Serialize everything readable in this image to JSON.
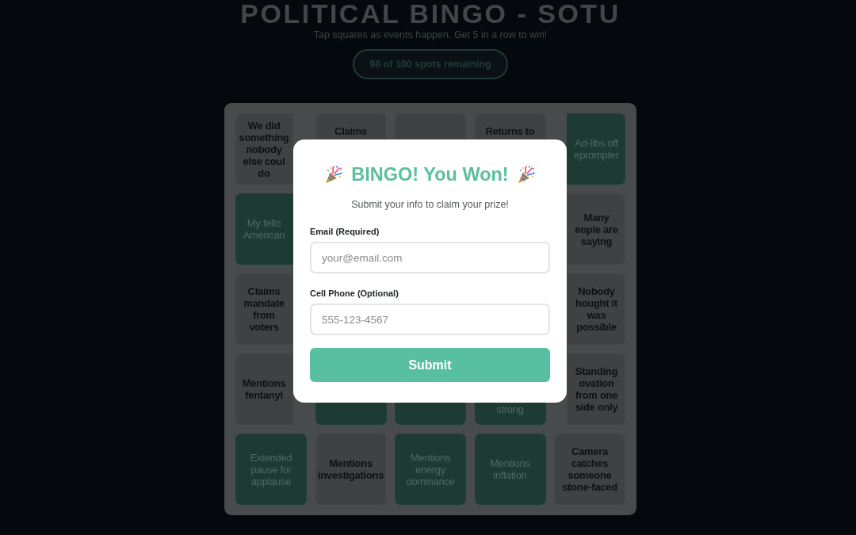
{
  "header": {
    "title": "POLITICAL BINGO - SOTU",
    "subtitle": "Tap squares as events happen. Get 5 in a row to win!",
    "spots_badge": "98 of 100 spots remaining"
  },
  "board": {
    "rows": [
      [
        {
          "text": "We did something nobody else coul do",
          "selected": false
        },
        {
          "text": "Claims",
          "selected": false
        },
        {
          "selected": false
        },
        {
          "text": "Returns to",
          "selected": false
        },
        {
          "text": "Ad-libs off eprompter",
          "selected": true
        }
      ],
      [
        {
          "text": "My fello American",
          "selected": true
        },
        null,
        null,
        null,
        {
          "text": "Many eople are saying",
          "selected": false
        }
      ],
      [
        {
          "text": "Claims mandate from voters",
          "selected": false
        },
        null,
        null,
        null,
        {
          "text": "Nobody hought it was possible",
          "selected": false
        }
      ],
      [
        {
          "text": "Mentions fentanyl",
          "selected": false
        },
        {
          "selected": true
        },
        {
          "selected": true
        },
        {
          "text": "strong",
          "selected": true
        },
        {
          "text": "Standing ovation from one side only",
          "selected": false
        }
      ],
      [
        {
          "text": "Extended pause for applause",
          "selected": true
        },
        {
          "text": "Mentions investigations",
          "selected": false
        },
        {
          "text": "Mentions energy dominance",
          "selected": true
        },
        {
          "text": "Mentions inflation",
          "selected": true
        },
        {
          "text": "Camera catches someone stone-faced",
          "selected": false
        }
      ]
    ]
  },
  "modal": {
    "title": "BINGO! You Won!",
    "subtitle": "Submit your info to claim your prize!",
    "fields": [
      {
        "label": "Email (Required)",
        "placeholder": "your@email.com"
      },
      {
        "label": "Cell Phone (Optional)",
        "placeholder": "555-123-4567"
      }
    ],
    "submit": "Submit"
  }
}
